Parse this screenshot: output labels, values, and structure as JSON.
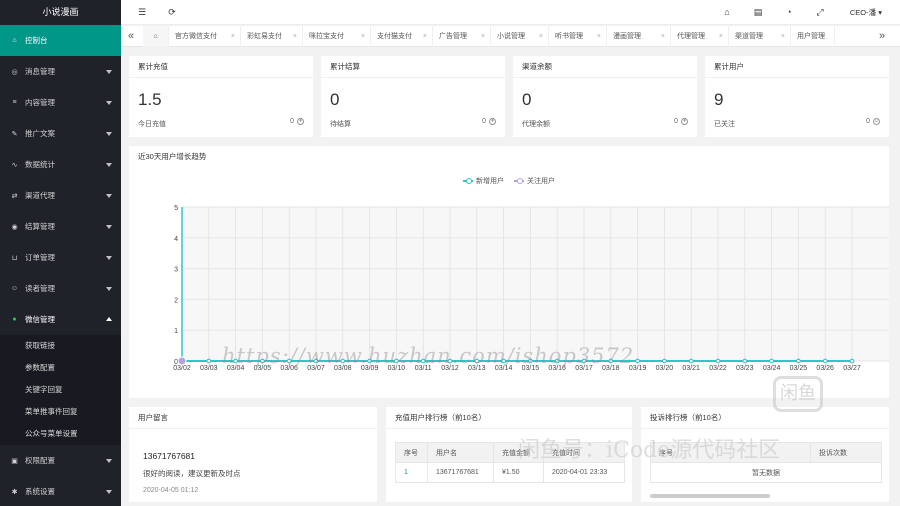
{
  "sidebar": {
    "logo": "小说漫画",
    "items": [
      {
        "label": "控制台",
        "icon": "home-icon",
        "active": true
      },
      {
        "label": "消息管理",
        "icon": "message-icon"
      },
      {
        "label": "内容管理",
        "icon": "list-icon"
      },
      {
        "label": "推广文案",
        "icon": "megaphone-icon"
      },
      {
        "label": "数据统计",
        "icon": "stats-icon"
      },
      {
        "label": "渠道代理",
        "icon": "channel-icon"
      },
      {
        "label": "结算管理",
        "icon": "settle-icon"
      },
      {
        "label": "订单管理",
        "icon": "cart-icon"
      },
      {
        "label": "读者管理",
        "icon": "user-icon"
      },
      {
        "label": "微信管理",
        "icon": "wechat-icon",
        "open": true
      }
    ],
    "submenu": [
      "获取链接",
      "参数配置",
      "关键字回复",
      "菜单推事件回复",
      "公众号菜单设置"
    ],
    "items_after": [
      {
        "label": "权限配置",
        "icon": "permission-icon"
      },
      {
        "label": "系统设置",
        "icon": "gear-icon"
      }
    ]
  },
  "header": {
    "user": "CEO-潘"
  },
  "tabs": [
    "官方微信支付",
    "彩虹易支付",
    "咪拉宝支付",
    "支付猫支付",
    "广告管理",
    "小说管理",
    "听书管理",
    "漫画管理",
    "代理管理",
    "渠道管理",
    "用户管理"
  ],
  "stats": [
    {
      "title": "累计充值",
      "value": "1.5",
      "sub": "今日充值",
      "right": "0"
    },
    {
      "title": "累计结算",
      "value": "0",
      "sub": "待结算",
      "right": "0"
    },
    {
      "title": "渠道余额",
      "value": "0",
      "sub": "代理余额",
      "right": "0"
    },
    {
      "title": "累计用户",
      "value": "9",
      "sub": "已关注",
      "right": "0"
    }
  ],
  "chart_card_title": "近30天用户增长趋势",
  "chart_data": {
    "type": "line",
    "title": "近30天用户增长趋势",
    "x": [
      "03/02",
      "03/03",
      "03/04",
      "03/05",
      "03/06",
      "03/07",
      "03/08",
      "03/09",
      "03/10",
      "03/11",
      "03/12",
      "03/13",
      "03/14",
      "03/15",
      "03/16",
      "03/17",
      "03/18",
      "03/19",
      "03/20",
      "03/21",
      "03/22",
      "03/23",
      "03/24",
      "03/25",
      "03/26",
      "03/27"
    ],
    "series": [
      {
        "name": "新增用户",
        "color": "#2ec7c9",
        "values": [
          0,
          0,
          0,
          0,
          0,
          0,
          0,
          0,
          0,
          0,
          0,
          0,
          0,
          0,
          0,
          0,
          0,
          0,
          0,
          0,
          0,
          0,
          0,
          0,
          0,
          0
        ]
      },
      {
        "name": "关注用户",
        "color": "#b6a2de",
        "values": [
          0,
          0,
          0,
          0,
          0,
          0,
          0,
          0,
          0,
          0,
          0,
          0,
          0,
          0,
          0,
          0,
          0,
          0,
          0,
          0,
          0,
          0,
          0,
          0,
          0,
          0
        ]
      }
    ],
    "ylim": [
      0,
      5
    ],
    "yticks": [
      0,
      1,
      2,
      3,
      4,
      5
    ],
    "legend": "top-center",
    "grid": true
  },
  "messages": {
    "title": "用户留言",
    "phone": "13671767681",
    "text": "很好的阅读，建议更新及时点",
    "time": "2020-04-05 01:12"
  },
  "recharge_rank": {
    "title": "充值用户排行榜（前10名）",
    "headers": [
      "序号",
      "用户名",
      "充值金额",
      "充值时间"
    ],
    "rows": [
      [
        "1",
        "13671767681",
        "¥1.50",
        "2020-04-01 23:33"
      ]
    ]
  },
  "complaint_rank": {
    "title": "投诉排行榜（前10名）",
    "headers": [
      "序号",
      "",
      "投诉次数"
    ],
    "empty": "暂无数据"
  },
  "watermarks": {
    "url": "https://www.huzhan.com/ishop3572",
    "brand": "闲鱼号：iCode源代码社区"
  }
}
